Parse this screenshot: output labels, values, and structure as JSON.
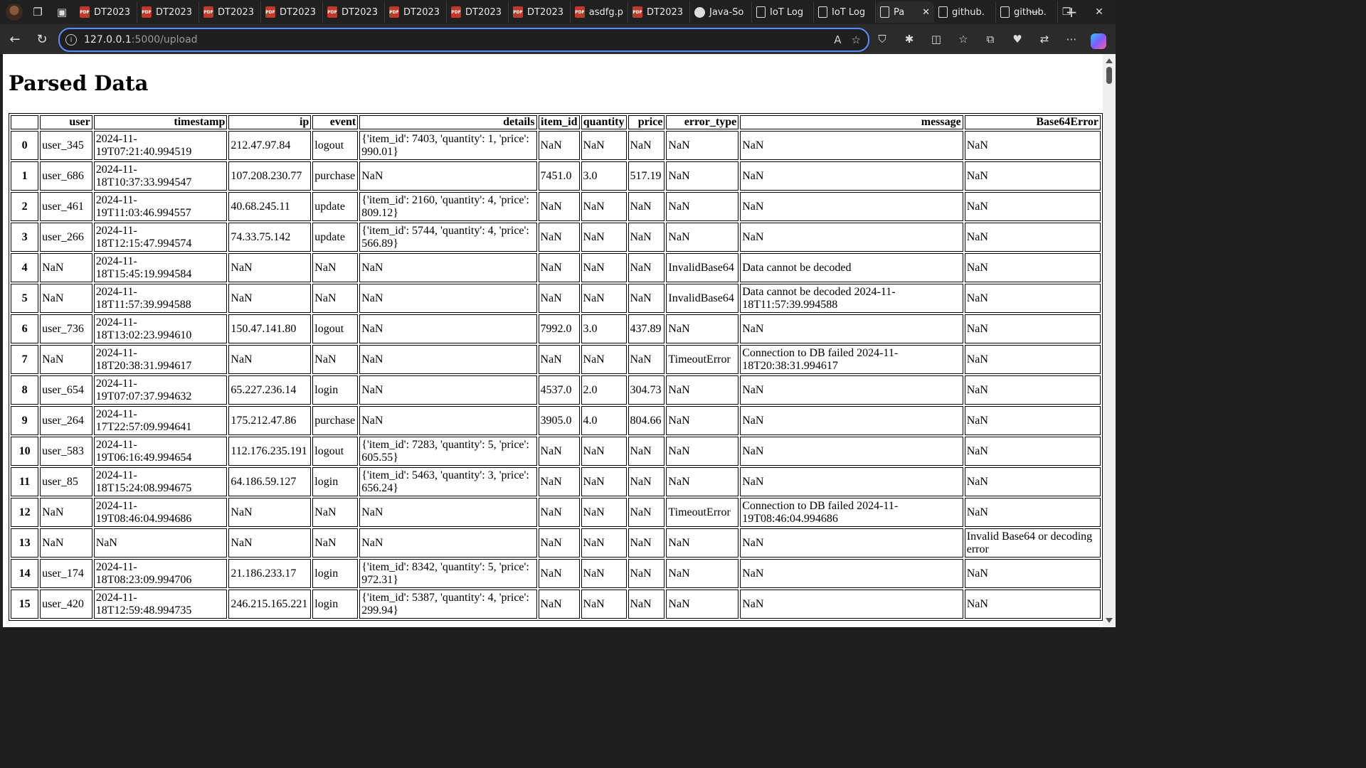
{
  "browser": {
    "tabs": [
      {
        "label": "DT2023",
        "icon": "pdf-icon"
      },
      {
        "label": "DT2023",
        "icon": "pdf-icon"
      },
      {
        "label": "DT2023",
        "icon": "pdf-icon"
      },
      {
        "label": "DT2023",
        "icon": "pdf-icon"
      },
      {
        "label": "DT2023",
        "icon": "pdf-icon"
      },
      {
        "label": "DT2023",
        "icon": "pdf-icon"
      },
      {
        "label": "DT2023",
        "icon": "pdf-icon"
      },
      {
        "label": "DT2023",
        "icon": "pdf-icon"
      },
      {
        "label": "asdfg.p",
        "icon": "pdf-icon"
      },
      {
        "label": "DT2023",
        "icon": "pdf-icon"
      },
      {
        "label": "Java-So",
        "icon": "github-icon"
      },
      {
        "label": "IoT Log",
        "icon": "document-icon"
      },
      {
        "label": "IoT Log",
        "icon": "document-icon"
      },
      {
        "label": "Pa",
        "icon": "document-icon",
        "active": true
      },
      {
        "label": "github.",
        "icon": "document-icon"
      },
      {
        "label": "github.",
        "icon": "document-icon"
      }
    ],
    "pdf_badge": "PDF",
    "address": {
      "host": "127.0.0.1",
      "path": ":5000/upload"
    }
  },
  "page": {
    "title": "Parsed Data",
    "columns": [
      "",
      "user",
      "timestamp",
      "ip",
      "event",
      "details",
      "item_id",
      "quantity",
      "price",
      "error_type",
      "message",
      "Base64Error"
    ],
    "rows": [
      [
        "0",
        "user_345",
        "2024-11-19T07:21:40.994519",
        "212.47.97.84",
        "logout",
        "{'item_id': 7403, 'quantity': 1, 'price': 990.01}",
        "NaN",
        "NaN",
        "NaN",
        "NaN",
        "NaN",
        "NaN"
      ],
      [
        "1",
        "user_686",
        "2024-11-18T10:37:33.994547",
        "107.208.230.77",
        "purchase",
        "NaN",
        "7451.0",
        "3.0",
        "517.19",
        "NaN",
        "NaN",
        "NaN"
      ],
      [
        "2",
        "user_461",
        "2024-11-19T11:03:46.994557",
        "40.68.245.11",
        "update",
        "{'item_id': 2160, 'quantity': 4, 'price': 809.12}",
        "NaN",
        "NaN",
        "NaN",
        "NaN",
        "NaN",
        "NaN"
      ],
      [
        "3",
        "user_266",
        "2024-11-18T12:15:47.994574",
        "74.33.75.142",
        "update",
        "{'item_id': 5744, 'quantity': 4, 'price': 566.89}",
        "NaN",
        "NaN",
        "NaN",
        "NaN",
        "NaN",
        "NaN"
      ],
      [
        "4",
        "NaN",
        "2024-11-18T15:45:19.994584",
        "NaN",
        "NaN",
        "NaN",
        "NaN",
        "NaN",
        "NaN",
        "InvalidBase64",
        "Data cannot be decoded",
        "NaN"
      ],
      [
        "5",
        "NaN",
        "2024-11-18T11:57:39.994588",
        "NaN",
        "NaN",
        "NaN",
        "NaN",
        "NaN",
        "NaN",
        "InvalidBase64",
        "Data cannot be decoded 2024-11-18T11:57:39.994588",
        "NaN"
      ],
      [
        "6",
        "user_736",
        "2024-11-18T13:02:23.994610",
        "150.47.141.80",
        "logout",
        "NaN",
        "7992.0",
        "3.0",
        "437.89",
        "NaN",
        "NaN",
        "NaN"
      ],
      [
        "7",
        "NaN",
        "2024-11-18T20:38:31.994617",
        "NaN",
        "NaN",
        "NaN",
        "NaN",
        "NaN",
        "NaN",
        "TimeoutError",
        "Connection to DB failed 2024-11-18T20:38:31.994617",
        "NaN"
      ],
      [
        "8",
        "user_654",
        "2024-11-19T07:07:37.994632",
        "65.227.236.14",
        "login",
        "NaN",
        "4537.0",
        "2.0",
        "304.73",
        "NaN",
        "NaN",
        "NaN"
      ],
      [
        "9",
        "user_264",
        "2024-11-17T22:57:09.994641",
        "175.212.47.86",
        "purchase",
        "NaN",
        "3905.0",
        "4.0",
        "804.66",
        "NaN",
        "NaN",
        "NaN"
      ],
      [
        "10",
        "user_583",
        "2024-11-19T06:16:49.994654",
        "112.176.235.191",
        "logout",
        "{'item_id': 7283, 'quantity': 5, 'price': 605.55}",
        "NaN",
        "NaN",
        "NaN",
        "NaN",
        "NaN",
        "NaN"
      ],
      [
        "11",
        "user_85",
        "2024-11-18T15:24:08.994675",
        "64.186.59.127",
        "login",
        "{'item_id': 5463, 'quantity': 3, 'price': 656.24}",
        "NaN",
        "NaN",
        "NaN",
        "NaN",
        "NaN",
        "NaN"
      ],
      [
        "12",
        "NaN",
        "2024-11-19T08:46:04.994686",
        "NaN",
        "NaN",
        "NaN",
        "NaN",
        "NaN",
        "NaN",
        "TimeoutError",
        "Connection to DB failed 2024-11-19T08:46:04.994686",
        "NaN"
      ],
      [
        "13",
        "NaN",
        "NaN",
        "NaN",
        "NaN",
        "NaN",
        "NaN",
        "NaN",
        "NaN",
        "NaN",
        "NaN",
        "Invalid Base64 or decoding error"
      ],
      [
        "14",
        "user_174",
        "2024-11-18T08:23:09.994706",
        "21.186.233.17",
        "login",
        "{'item_id': 8342, 'quantity': 5, 'price': 972.31}",
        "NaN",
        "NaN",
        "NaN",
        "NaN",
        "NaN",
        "NaN"
      ],
      [
        "15",
        "user_420",
        "2024-11-18T12:59:48.994735",
        "246.215.165.221",
        "login",
        "{'item_id': 5387, 'quantity': 4, 'price': 299.94}",
        "NaN",
        "NaN",
        "NaN",
        "NaN",
        "NaN",
        "NaN"
      ]
    ]
  }
}
